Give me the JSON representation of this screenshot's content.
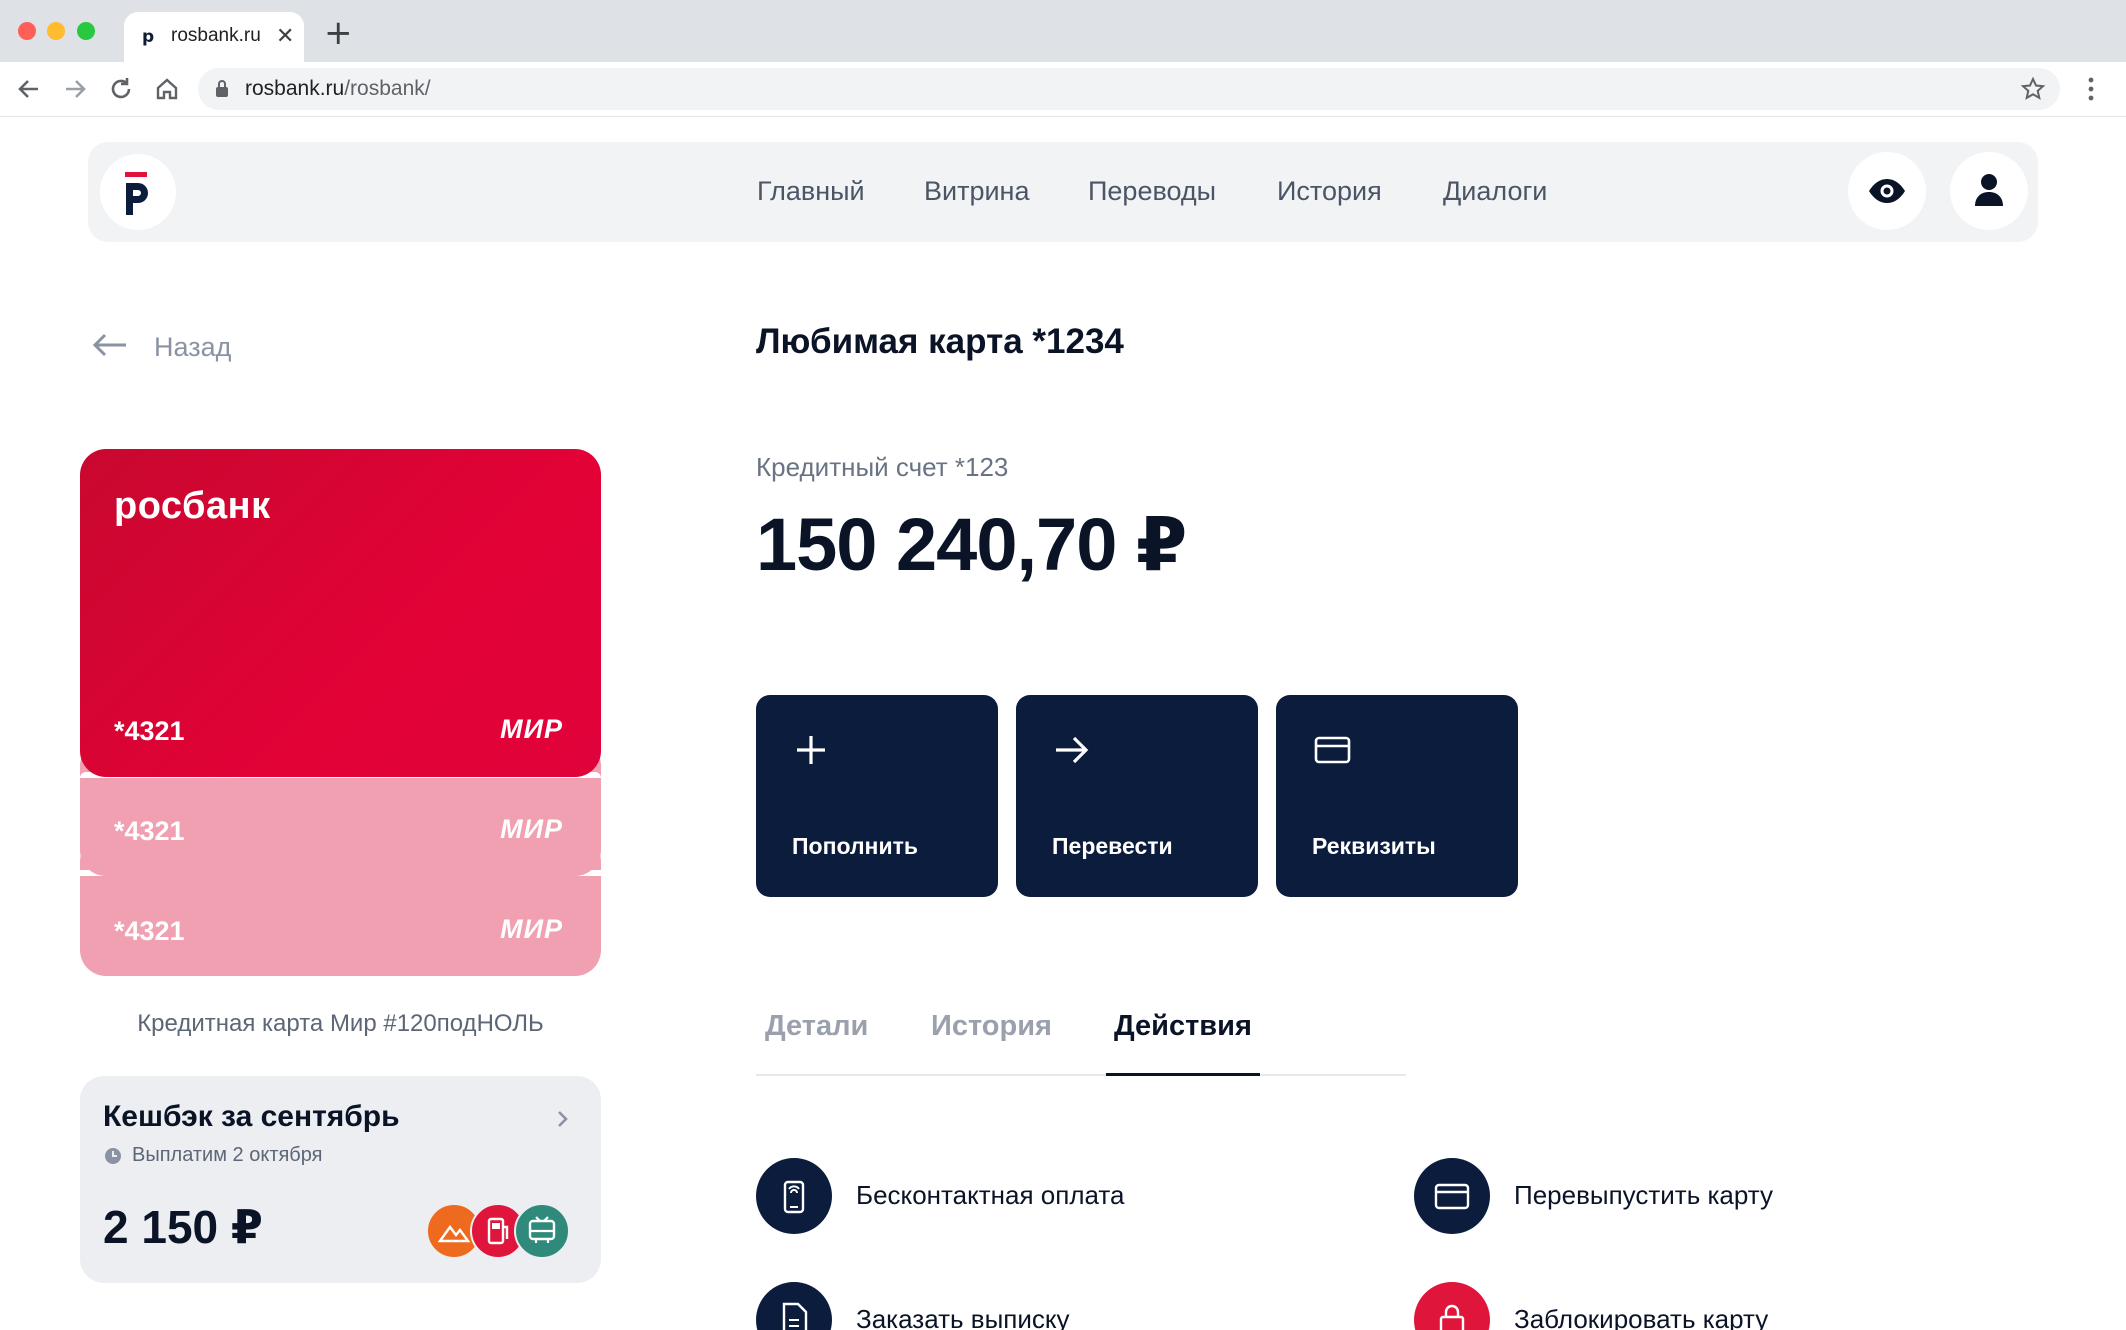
{
  "browser": {
    "tab_title": "rosbank.ru",
    "favicon_letter": "р",
    "url_domain": "rosbank.ru",
    "url_path": "/rosbank/"
  },
  "header": {
    "nav": [
      "Главный",
      "Витрина",
      "Переводы",
      "История",
      "Диалоги"
    ],
    "logo_letter": "р"
  },
  "back": {
    "label": "Назад"
  },
  "cards": {
    "brand": "росбанк",
    "items": [
      {
        "number": "*4321",
        "system": "МИР"
      },
      {
        "number": "*4321",
        "system": "МИР"
      },
      {
        "number": "*4321",
        "system": "МИР"
      }
    ],
    "caption": "Кредитная карта Мир #120подНОЛЬ"
  },
  "cashback": {
    "title": "Кешбэк за сентябрь",
    "payout": "Выплатим 2 октября",
    "amount": "2 150 ₽",
    "category_colors": [
      "#ee6a1f",
      "#e0153c",
      "#2f8a7b"
    ]
  },
  "account": {
    "title": "Любимая карта *1234",
    "subtitle": "Кредитный счет *123",
    "balance": "150 240,70 ₽"
  },
  "actions": [
    {
      "label": "Пополнить",
      "icon": "plus-icon"
    },
    {
      "label": "Перевести",
      "icon": "arrow-right-icon"
    },
    {
      "label": "Реквизиты",
      "icon": "card-icon"
    }
  ],
  "tabs": [
    "Детали",
    "История",
    "Действия"
  ],
  "active_tab": "Действия",
  "operations": [
    {
      "label": "Бесконтактная оплата",
      "icon": "contactless-phone-icon",
      "color": "#0c1c3d"
    },
    {
      "label": "Перевыпустить карту",
      "icon": "card-icon",
      "color": "#0c1c3d"
    },
    {
      "label": "Заказать выписку",
      "icon": "document-icon",
      "color": "#0c1c3d"
    },
    {
      "label": "Заблокировать карту",
      "icon": "lock-icon",
      "color": "#e0153c"
    }
  ],
  "colors": {
    "navy": "#0c1c3d",
    "brand_red": "#e0113a",
    "card_pink": "#f0a0b0"
  }
}
